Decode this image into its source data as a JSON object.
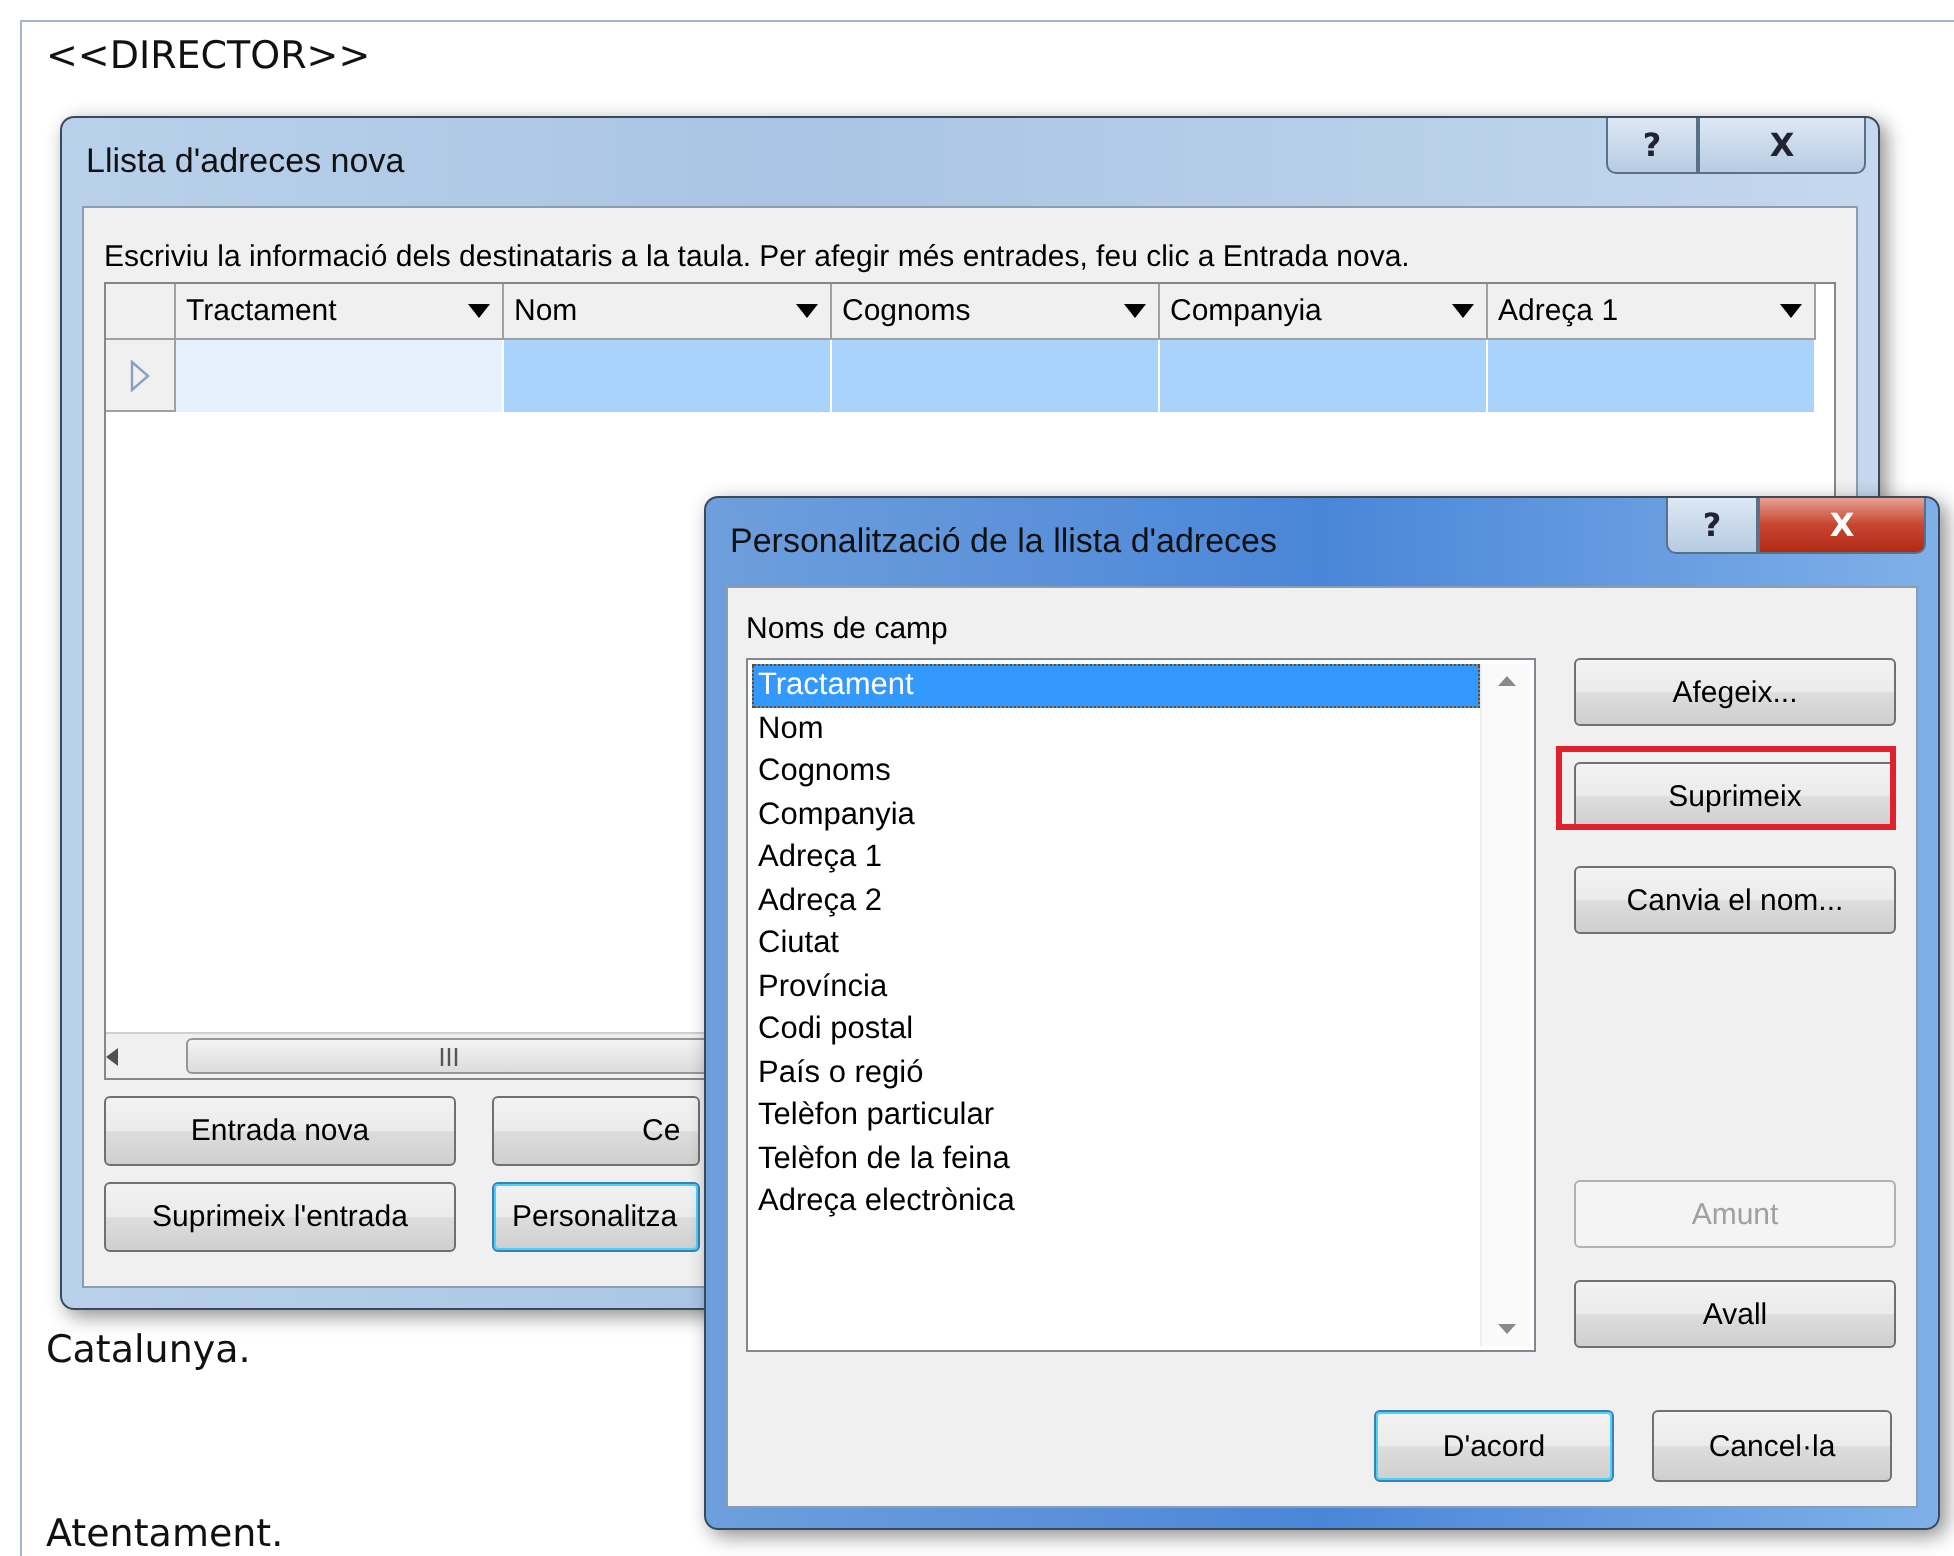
{
  "document": {
    "lines": [
      {
        "text": "<<DIRECTOR>>"
      },
      {
        "text": "Catalunya."
      },
      {
        "text": "Atentament."
      }
    ]
  },
  "address_list_dialog": {
    "title": "Llista d'adreces nova",
    "help": "?",
    "close": "X",
    "instruction": "Escriviu la informació dels destinataris a la taula. Per afegir més entrades, feu clic a Entrada nova.",
    "table": {
      "columns": [
        "Tractament",
        "Nom",
        "Cognoms",
        "Companyia",
        "Adreça 1"
      ],
      "rows": [
        {
          "selected": true
        }
      ]
    },
    "buttons": [
      {
        "label": "Entrada nova",
        "focused": false
      },
      {
        "label": "Ce",
        "focused": false
      },
      {
        "label": "Suprimeix l'entrada",
        "focused": false
      },
      {
        "label": "Personalitza",
        "focused": true
      }
    ]
  },
  "customize_dialog": {
    "title": "Personalització de la llista d'adreces",
    "help": "?",
    "close": "X",
    "field_names_label": "Noms de camp",
    "fields": [
      {
        "label": "Tractament",
        "selected": true
      },
      {
        "label": "Nom",
        "selected": false
      },
      {
        "label": "Cognoms",
        "selected": false
      },
      {
        "label": "Companyia",
        "selected": false
      },
      {
        "label": "Adreça 1",
        "selected": false
      },
      {
        "label": "Adreça 2",
        "selected": false
      },
      {
        "label": "Ciutat",
        "selected": false
      },
      {
        "label": "Província",
        "selected": false
      },
      {
        "label": "Codi postal",
        "selected": false
      },
      {
        "label": "País o regió",
        "selected": false
      },
      {
        "label": "Telèfon particular",
        "selected": false
      },
      {
        "label": "Telèfon de la feina",
        "selected": false
      },
      {
        "label": "Adreça electrònica",
        "selected": false
      }
    ],
    "edit_buttons": [
      {
        "label": "Afegeix...",
        "highlighted": false
      },
      {
        "label": "Suprimeix",
        "highlighted": true
      },
      {
        "label": "Canvia el nom...",
        "highlighted": false
      }
    ],
    "order_buttons": [
      {
        "label": "Amunt",
        "disabled": true
      },
      {
        "label": "Avall",
        "disabled": false
      }
    ],
    "footer_buttons": [
      {
        "label": "D'acord",
        "focused": true
      },
      {
        "label": "Cancel·la",
        "focused": false
      }
    ]
  }
}
